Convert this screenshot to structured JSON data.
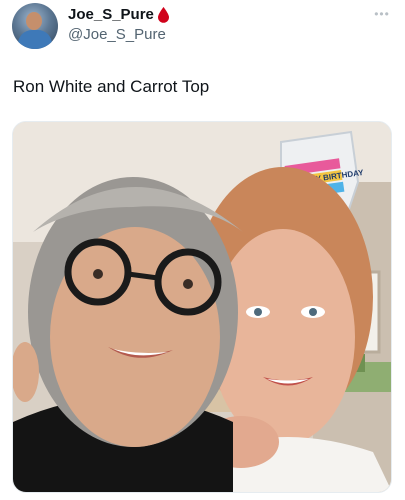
{
  "user": {
    "display_name": "Joe_S_Pure",
    "handle": "@Joe_S_Pure",
    "badge_icon": "blood-drop-icon",
    "badge_color": "#d0021b"
  },
  "more_menu": {
    "icon": "more-horizontal-icon",
    "glyph": "•••"
  },
  "tweet": {
    "text": "Ron White and Carrot Top",
    "balloon_text": "HAPPY BIRTHDAY"
  }
}
